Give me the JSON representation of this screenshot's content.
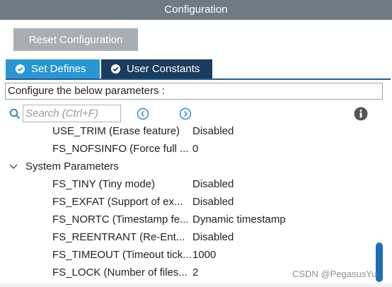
{
  "panel": {
    "title": "Configuration"
  },
  "toolbar": {
    "reset_label": "Reset Configuration"
  },
  "tabs": [
    {
      "label": "Set Defines",
      "active": true
    },
    {
      "label": "User Constants",
      "active": false
    }
  ],
  "description": "Configure the below parameters :",
  "search": {
    "placeholder": "Search (Ctrl+F)",
    "value": ""
  },
  "icons": {
    "search": "search-icon",
    "prev": "nav-prev-icon",
    "next": "nav-next-icon",
    "info": "info-icon",
    "group": "chevron-down-icon",
    "tab_check": "check-circle-icon"
  },
  "params_top": [
    {
      "name": "USE_TRIM (Erase feature)",
      "value": "Disabled"
    },
    {
      "name": "FS_NOFSINFO (Force full ...",
      "value": "0"
    }
  ],
  "group": {
    "label": "System Parameters",
    "expanded": true
  },
  "params_system": [
    {
      "name": "FS_TINY (Tiny mode)",
      "value": "Disabled"
    },
    {
      "name": "FS_EXFAT (Support of ex...",
      "value": "Disabled"
    },
    {
      "name": "FS_NORTC (Timestamp fe...",
      "value": "Dynamic timestamp"
    },
    {
      "name": "FS_REENTRANT (Re-Ent...",
      "value": "Disabled"
    },
    {
      "name": "FS_TIMEOUT (Timeout tick...",
      "value": "1000"
    },
    {
      "name": "FS_LOCK (Number of files...",
      "value": "2"
    }
  ],
  "watermark": "CSDN @PegasusYu",
  "colors": {
    "title_bar": "#6f7a83",
    "tab_active": "#2a96d4",
    "tab_inactive": "#1a3c5e",
    "reset_button": "#a9aeb3",
    "scroll_thumb": "#1f6fb7",
    "icon_blue": "#2a8fd6"
  }
}
